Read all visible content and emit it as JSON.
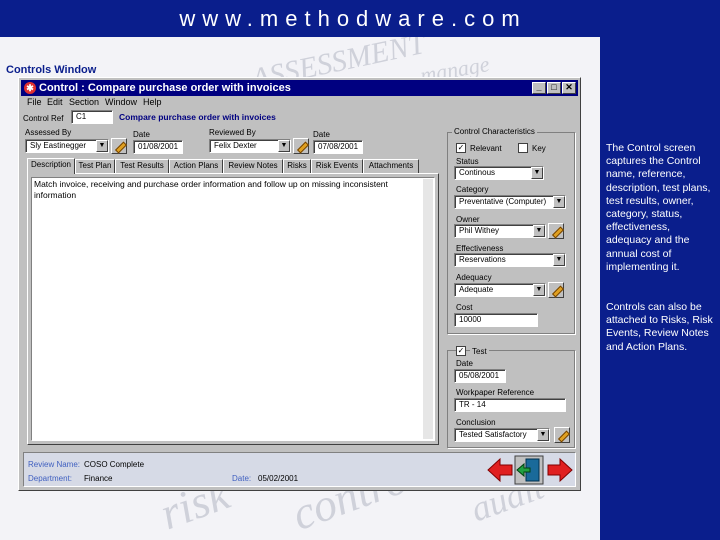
{
  "banner": {
    "title": "www.methodware.com"
  },
  "caption": "Controls Window",
  "side_text": {
    "para1": "The Control screen captures the Control name, reference, description, test plans, test results, owner, category, status, effectiveness, adequacy and the annual cost of implementing it.",
    "para2": "Controls can also be attached to Risks, Risk Events, Review Notes and Action Plans."
  },
  "window": {
    "title": "Control : Compare purchase order with invoices",
    "menu": [
      "File",
      "Edit",
      "Section",
      "Window",
      "Help"
    ]
  },
  "control_ref": {
    "label": "Control Ref",
    "value": "C1",
    "name": "Compare purchase order with invoices"
  },
  "assessed_by": {
    "label": "Assessed By",
    "value": "Sly Eastinegger"
  },
  "date1": {
    "label": "Date",
    "value": "01/08/2001"
  },
  "reviewed_by": {
    "label": "Reviewed By",
    "value": "Felix Dexter"
  },
  "date2": {
    "label": "Date",
    "value": "07/08/2001"
  },
  "tabs": [
    "Description",
    "Test Plan",
    "Test Results",
    "Action Plans",
    "Review Notes",
    "Risks",
    "Risk Events",
    "Attachments"
  ],
  "description_text": "Match invoice, receiving and purchase order information and follow up on missing inconsistent information",
  "characteristics": {
    "title": "Control Characteristics",
    "relevant_label": "Relevant",
    "key_label": "Key",
    "status_label": "Status",
    "status_value": "Continous",
    "category_label": "Category",
    "category_value": "Preventative (Computer)",
    "owner_label": "Owner",
    "owner_value": "Phil Withey",
    "effectiveness_label": "Effectiveness",
    "effectiveness_value": "Reservations",
    "adequacy_label": "Adequacy",
    "adequacy_value": "Adequate",
    "cost_label": "Cost",
    "cost_value": "10000"
  },
  "test": {
    "title": "Test",
    "date_label": "Date",
    "date_value": "05/08/2001",
    "workpaper_label": "Workpaper Reference",
    "workpaper_value": "TR - 14",
    "conclusion_label": "Conclusion",
    "conclusion_value": "Tested Satisfactory"
  },
  "statusbar": {
    "review_name_label": "Review Name:",
    "review_name_value": "COSO Complete",
    "department_label": "Department:",
    "department_value": "Finance",
    "date_label": "Date:",
    "date_value": "05/02/2001"
  },
  "colors": {
    "banner": "#0a1e8c",
    "titlebar": "#000080",
    "window": "#c0c0c0",
    "nav_arrow": "#e02020"
  }
}
